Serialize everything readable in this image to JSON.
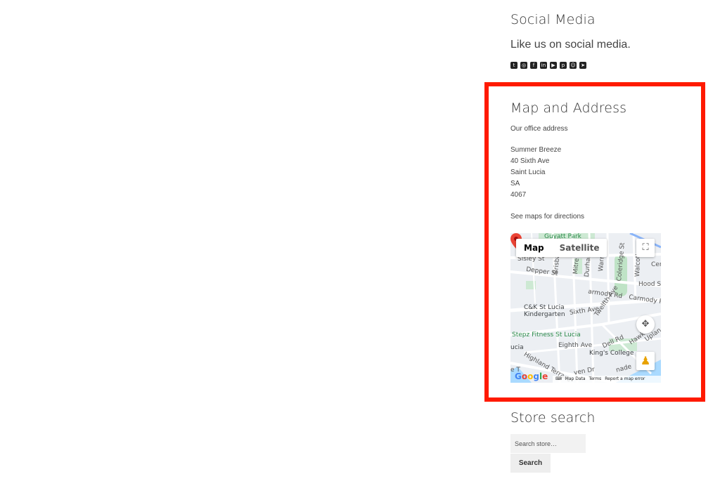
{
  "social": {
    "title": "Social Media",
    "text": "Like us on social media.",
    "icons": [
      "twitter-icon",
      "instagram-icon",
      "facebook-icon",
      "linkedin-icon",
      "youtube-icon",
      "pinterest-icon",
      "snapchat-icon",
      "telegram-icon"
    ]
  },
  "map_widget": {
    "title": "Map and Address",
    "office_label": "Our office address",
    "address_lines": [
      "Summer Breeze",
      "40 Sixth Ave",
      "Saint Lucia",
      "SA",
      "4067"
    ],
    "directions": "See maps for directions",
    "map": {
      "toggle_map": "Map",
      "toggle_satellite": "Satellite",
      "labels": {
        "park": "Guyatt Park",
        "sisley": "Sisley St",
        "depper": "Depper St",
        "brisbane": "Brisbane St",
        "mitre": "Mitre St",
        "durham": "Durham",
        "warren": "Warren St",
        "coleridge": "Coleridge St",
        "walcott": "Walcott",
        "cer": "Cer",
        "hood": "Hood St",
        "carmody1": "armody Rd",
        "carmody2": "Carmody R",
        "kindergarten1": "C&K St Lucia",
        "kindergarten2": "Kindergarten",
        "sixth": "Sixth Ave",
        "twelfth": "Twelfth Ave",
        "stepz": "Stepz Fitness St Lucia",
        "eighth": "Eighth Ave",
        "dell": "Dell Rd",
        "hawk": "Hawk",
        "upland": "Uplan",
        "kings": "King's College",
        "lucia": "ucia",
        "highland": "Highland Terrace",
        "ven": "ven Dr",
        "nade": "nade",
        "te": "e T"
      },
      "google": [
        "G",
        "o",
        "o",
        "g",
        "l",
        "e"
      ],
      "attribution": {
        "keyboard": "⌨",
        "map_data": "Map Data",
        "terms": "Terms",
        "report": "Report a map error"
      }
    }
  },
  "store_search": {
    "title": "Store search",
    "placeholder": "Search store…",
    "button": "Search"
  },
  "colors": {
    "highlight": "#ff1a00",
    "pin": "#ea4335"
  }
}
